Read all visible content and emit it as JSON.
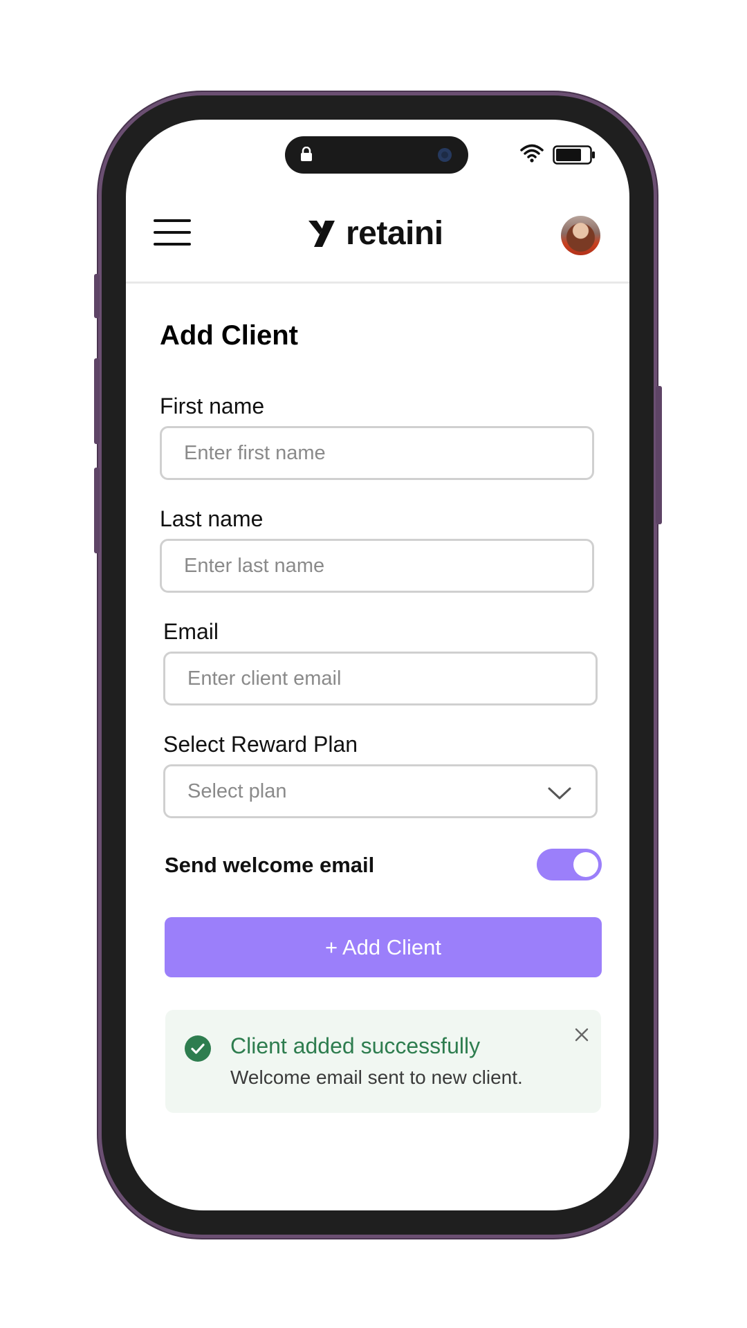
{
  "app": {
    "brand": "retaini"
  },
  "header": {
    "menu_icon": "hamburger-menu-icon",
    "avatar_icon": "user-avatar"
  },
  "form": {
    "title": "Add Client",
    "first_name": {
      "label": "First name",
      "placeholder": "Enter first name"
    },
    "last_name": {
      "label": "Last name",
      "placeholder": "Enter last name"
    },
    "email": {
      "label": "Email",
      "placeholder": "Enter client email"
    },
    "reward_plan": {
      "label": "Select Reward Plan",
      "placeholder": "Select plan"
    },
    "welcome_email": {
      "label": "Send welcome email",
      "enabled": true
    },
    "submit_label": "+ Add Client"
  },
  "toast": {
    "title": "Client added successfully",
    "message": "Welcome email sent to new client.",
    "status": "success"
  },
  "colors": {
    "accent": "#9b7ffa",
    "success": "#2e7d4f",
    "toast_bg": "#f1f7f2",
    "frame": "#6b4f72"
  }
}
